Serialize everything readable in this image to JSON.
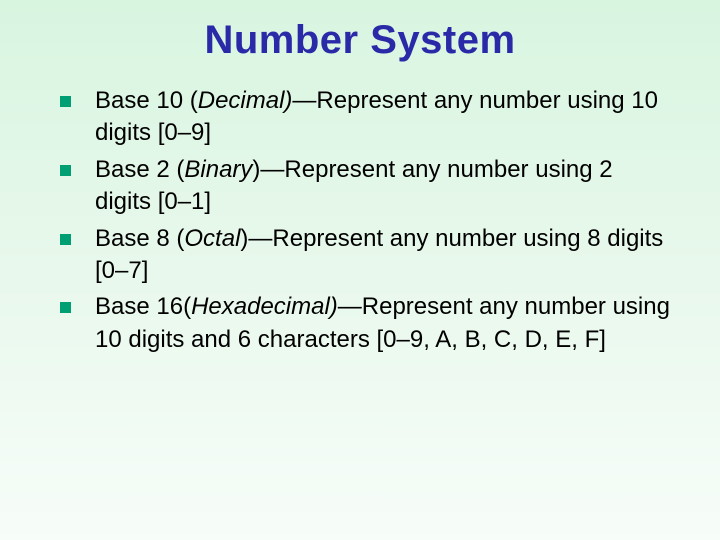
{
  "title": "Number System",
  "items": [
    {
      "base_prefix": "Base 10 (",
      "base_name": "Decimal)",
      "rest": "—Represent any number using 10 digits [0–9]"
    },
    {
      "base_prefix": "Base 2 (",
      "base_name": "Binary",
      "rest": ")—Represent any number using 2 digits [0–1]"
    },
    {
      "base_prefix": "Base 8 (",
      "base_name": "Octal",
      "rest": ")—Represent any number using 8 digits [0–7]"
    },
    {
      "base_prefix": "Base 16(",
      "base_name": "Hexadecimal)",
      "rest": "—Represent any number using 10 digits and 6 characters [0–9, A, B, C, D, E, F]"
    }
  ]
}
